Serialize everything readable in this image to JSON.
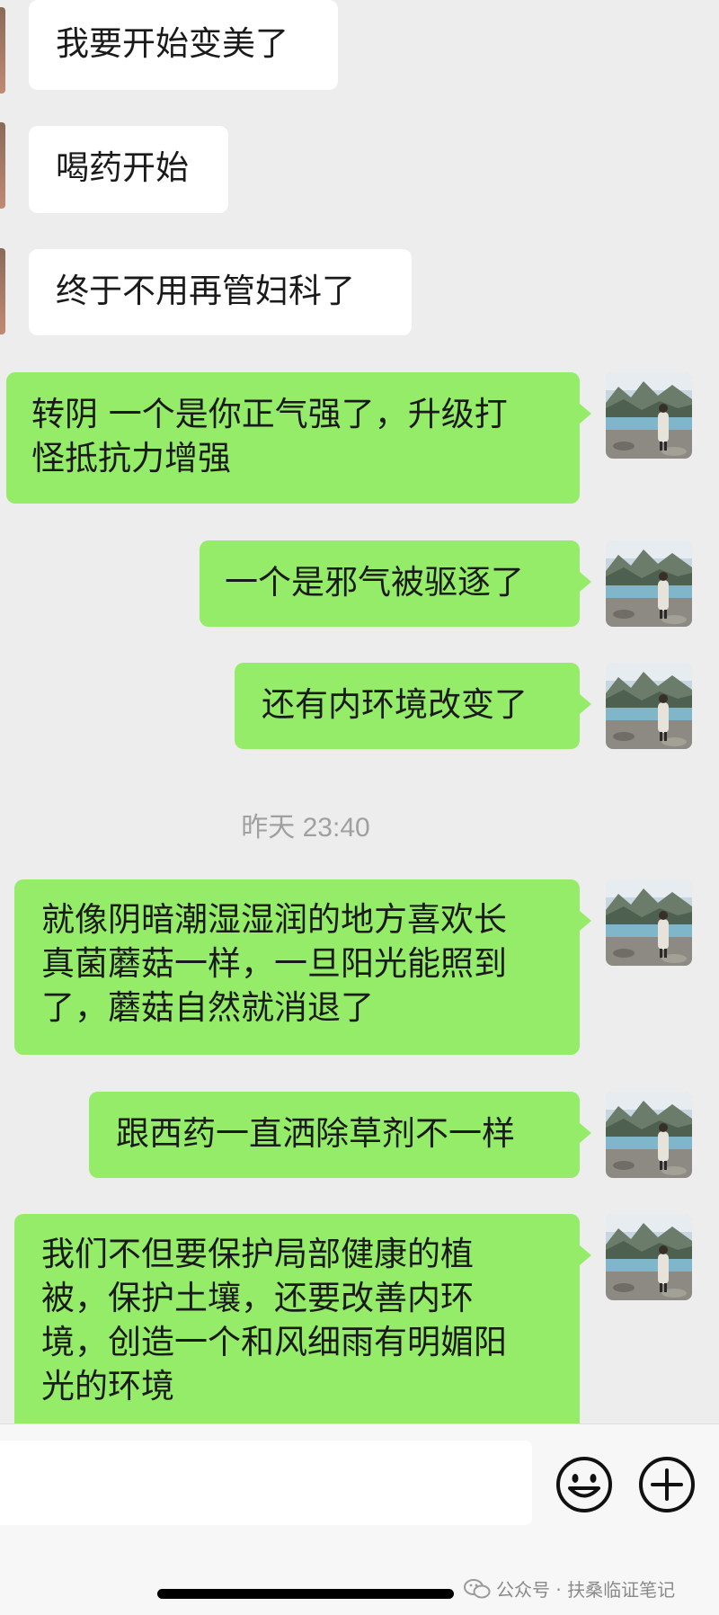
{
  "messages": [
    {
      "side": "left",
      "text": "我要开始变美了"
    },
    {
      "side": "left",
      "text": "喝药开始"
    },
    {
      "side": "left",
      "text": "终于不用再管妇科了"
    },
    {
      "side": "right",
      "lines": [
        "转阴 一个是你正气强了，升级打",
        "怪抵抗力增强"
      ]
    },
    {
      "side": "right",
      "text": "一个是邪气被驱逐了"
    },
    {
      "side": "right",
      "text": "还有内环境改变了"
    },
    {
      "side": "right",
      "lines": [
        "就像阴暗潮湿湿润的地方喜欢长",
        "真菌蘑菇一样，一旦阳光能照到",
        "了，蘑菇自然就消退了"
      ]
    },
    {
      "side": "right",
      "text": "跟西药一直洒除草剂不一样"
    },
    {
      "side": "right",
      "lines": [
        "我们不但要保护局部健康的植",
        "被，保护土壤，还要改善内环",
        "境，创造一个和风细雨有明媚阳",
        "光的环境"
      ]
    }
  ],
  "timestamp": "昨天 23:40",
  "input_bar": {
    "emoji_icon": "emoji-icon",
    "plus_icon": "plus-icon"
  },
  "watermark": "公众号 · 扶桑临证笔记",
  "colors": {
    "background": "#ededed",
    "sent_bubble": "#95ec69",
    "received_bubble": "#ffffff"
  }
}
